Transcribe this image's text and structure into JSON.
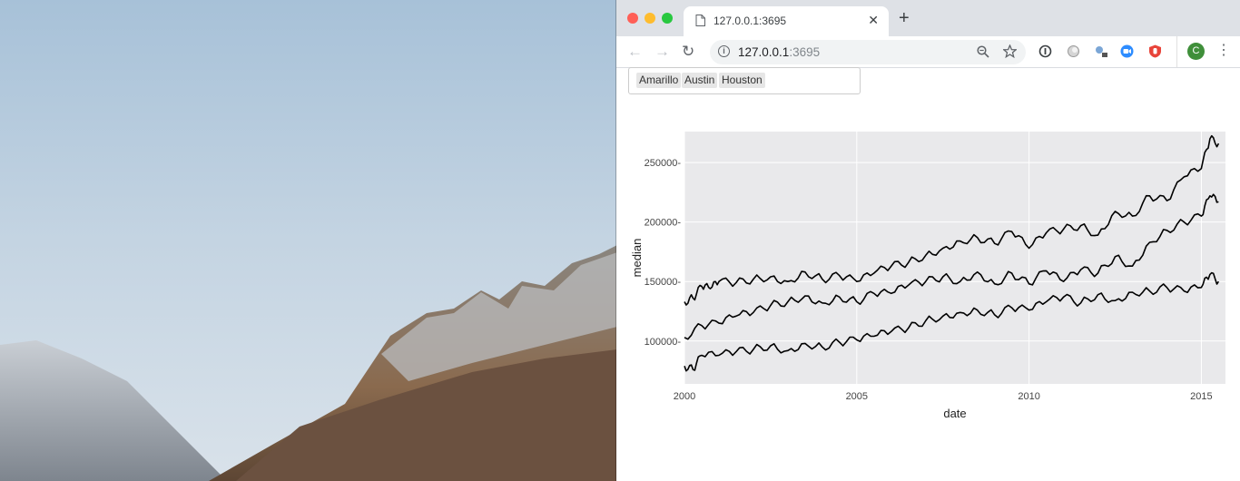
{
  "browser": {
    "tab_title": "127.0.0.1:3695",
    "url_host": "127.0.0.1",
    "url_port": ":3695",
    "profile_initial": "C",
    "colors": {
      "close": "#ff5f57",
      "minimize": "#febc2e",
      "zoom": "#28c840",
      "profile": "#3f8f3a"
    }
  },
  "selector": {
    "chips": [
      "Amarillo",
      "Austin",
      "Houston"
    ]
  },
  "chart_data": {
    "type": "line",
    "xlabel": "date",
    "ylabel": "median",
    "xlim": [
      2000,
      2015.7
    ],
    "ylim": [
      64000,
      276000
    ],
    "x_ticks": [
      "2000",
      "2005",
      "2010",
      "2015"
    ],
    "y_ticks": [
      "100000",
      "150000",
      "200000",
      "250000"
    ],
    "grid": true,
    "background": "#e9e9eb",
    "line_color": "#000000",
    "series": [
      {
        "x": [
          2000,
          2000.25,
          2000.5,
          2000.75,
          2001,
          2001.5,
          2002,
          2002.5,
          2003,
          2003.5,
          2004,
          2004.5,
          2005,
          2005.5,
          2006,
          2006.5,
          2007,
          2007.5,
          2008,
          2008.5,
          2009,
          2009.5,
          2010,
          2010.5,
          2011,
          2011.5,
          2012,
          2012.5,
          2013,
          2013.5,
          2014,
          2014.5,
          2015,
          2015.25,
          2015.5
        ],
        "values": [
          133000,
          136000,
          146000,
          144000,
          150000,
          149000,
          152000,
          154000,
          150000,
          158000,
          152000,
          155000,
          150000,
          157000,
          163000,
          166000,
          172000,
          178000,
          184000,
          187000,
          182000,
          192000,
          178000,
          191000,
          194000,
          197000,
          189000,
          209000,
          205000,
          222000,
          218000,
          238000,
          245000,
          270000,
          266000
        ]
      },
      {
        "x": [
          2000,
          2000.5,
          2001,
          2001.5,
          2002,
          2002.5,
          2003,
          2003.5,
          2004,
          2004.5,
          2005,
          2005.5,
          2006,
          2006.5,
          2007,
          2007.5,
          2008,
          2008.5,
          2009,
          2009.5,
          2010,
          2010.5,
          2011,
          2011.5,
          2012,
          2012.5,
          2013,
          2013.5,
          2014,
          2014.5,
          2015,
          2015.25,
          2015.5
        ],
        "values": [
          103000,
          113000,
          115000,
          121000,
          124000,
          130000,
          133000,
          138000,
          132000,
          137000,
          133000,
          140000,
          140000,
          147000,
          150000,
          154000,
          150000,
          158000,
          148000,
          157000,
          148000,
          159000,
          150000,
          160000,
          157000,
          171000,
          163000,
          183000,
          193000,
          200000,
          205000,
          222000,
          217000
        ]
      },
      {
        "x": [
          2000,
          2000.25,
          2000.5,
          2001,
          2001.5,
          2002,
          2002.5,
          2003,
          2003.5,
          2004,
          2004.5,
          2005,
          2005.5,
          2006,
          2006.5,
          2007,
          2007.5,
          2008,
          2008.5,
          2009,
          2009.5,
          2010,
          2010.5,
          2011,
          2011.5,
          2012,
          2012.5,
          2013,
          2013.5,
          2014,
          2014.5,
          2015,
          2015.25,
          2015.5
        ],
        "values": [
          79000,
          76000,
          88000,
          88000,
          91000,
          93000,
          96000,
          92000,
          98000,
          95000,
          99000,
          101000,
          104000,
          108000,
          111000,
          117000,
          121000,
          124000,
          126000,
          122000,
          128000,
          126000,
          133000,
          137000,
          132000,
          139000,
          134000,
          141000,
          142000,
          145000,
          142000,
          145000,
          156000,
          150000
        ]
      }
    ]
  }
}
